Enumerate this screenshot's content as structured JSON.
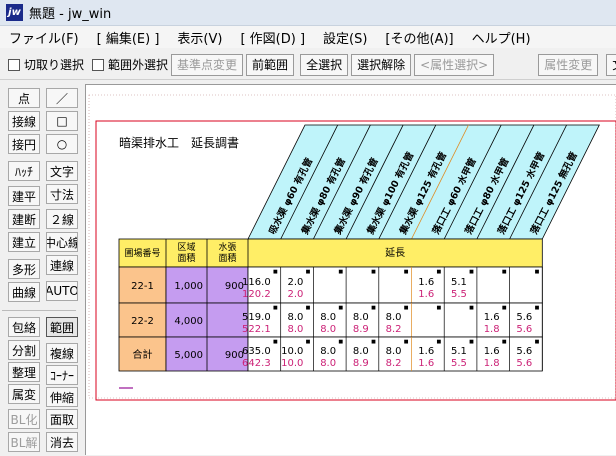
{
  "window": {
    "title": "無題 - jw_win",
    "icon_text": "jw"
  },
  "menu": [
    "ファイル(F)",
    "[ 編集(E) ]",
    "表示(V)",
    "[ 作図(D) ]",
    "設定(S)",
    "[その他(A)]",
    "ヘルプ(H)"
  ],
  "toolbar": {
    "check_crop": "切取り選択",
    "check_outside": "範囲外選択",
    "base_change": "基準点変更",
    "prev_range": "前範囲",
    "select_all": "全選択",
    "deselect": "選択解除",
    "attr_select": "<属性選択>",
    "attr_change": "属性変更",
    "cut_text": "文"
  },
  "left_tools": {
    "col1": [
      "点",
      "接線",
      "接円",
      "ﾊｯﾁ",
      "建平",
      "建断",
      "建立",
      "多形",
      "曲線",
      "包絡",
      "分割",
      "整理",
      "属変",
      "BL化",
      "BL解"
    ],
    "col2": [
      "／",
      "□",
      "○",
      "文字",
      "寸法",
      "２線",
      "中心線",
      "連線",
      "AUTO",
      "範囲",
      "複線",
      "ｺｰﾅｰ",
      "伸縮",
      "面取",
      "消去"
    ]
  },
  "document": {
    "title": "暗渠排水工　延長調書",
    "headers": {
      "field_no": "圃場番号",
      "area1": "区域",
      "area2": "面積",
      "water1": "水張",
      "water2": "面積",
      "extension": "延長"
    },
    "diag_labels": [
      "吸水渠 φ60 有孔管",
      "集水渠 φ80 有孔管",
      "集水渠 φ90 有孔管",
      "集水渠 φ100 有孔管",
      "集水渠 φ125 有孔管",
      "落口工 φ60 水甲管",
      "落口工 φ80 水甲管",
      "落口工 φ125 水甲管",
      "落口工 φ125 無孔管"
    ],
    "rows": [
      {
        "id": "22-1",
        "area": "1,000",
        "water": "900",
        "top": [
          "116.0",
          "2.0",
          "",
          "",
          "",
          "1.6",
          "5.1",
          "",
          ""
        ],
        "bot": [
          "120.2",
          "2.0",
          "",
          "",
          "",
          "1.6",
          "5.5",
          "",
          ""
        ]
      },
      {
        "id": "22-2",
        "area": "4,000",
        "water": "",
        "top": [
          "519.0",
          "8.0",
          "8.0",
          "8.0",
          "8.0",
          "",
          "",
          "1.6",
          "5.6"
        ],
        "bot": [
          "522.1",
          "8.0",
          "8.0",
          "8.9",
          "8.2",
          "",
          "",
          "1.8",
          "5.6"
        ]
      },
      {
        "id": "合計",
        "area": "5,000",
        "water": "900",
        "top": [
          "635.0",
          "10.0",
          "8.0",
          "8.0",
          "8.0",
          "1.6",
          "5.1",
          "1.6",
          "5.6"
        ],
        "bot": [
          "642.3",
          "10.0",
          "8.0",
          "8.9",
          "8.2",
          "1.6",
          "5.5",
          "1.8",
          "5.6"
        ]
      }
    ],
    "colors": {
      "orange": "#fbc48c",
      "purple": "#c59cf0",
      "yellow": "#ffee66",
      "cyan": "#bff4fa",
      "magenta": "#cc2277",
      "frame": "#d8001e"
    }
  }
}
